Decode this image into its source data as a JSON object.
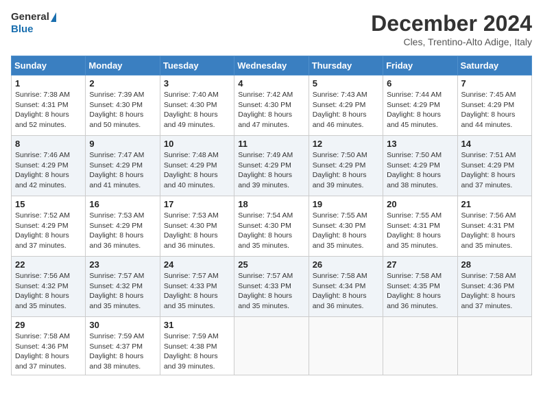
{
  "header": {
    "logo_line1": "General",
    "logo_line2": "Blue",
    "month_title": "December 2024",
    "location": "Cles, Trentino-Alto Adige, Italy"
  },
  "weekdays": [
    "Sunday",
    "Monday",
    "Tuesday",
    "Wednesday",
    "Thursday",
    "Friday",
    "Saturday"
  ],
  "weeks": [
    [
      {
        "day": "1",
        "sunrise": "7:38 AM",
        "sunset": "4:31 PM",
        "daylight": "8 hours and 52 minutes."
      },
      {
        "day": "2",
        "sunrise": "7:39 AM",
        "sunset": "4:30 PM",
        "daylight": "8 hours and 50 minutes."
      },
      {
        "day": "3",
        "sunrise": "7:40 AM",
        "sunset": "4:30 PM",
        "daylight": "8 hours and 49 minutes."
      },
      {
        "day": "4",
        "sunrise": "7:42 AM",
        "sunset": "4:30 PM",
        "daylight": "8 hours and 47 minutes."
      },
      {
        "day": "5",
        "sunrise": "7:43 AM",
        "sunset": "4:29 PM",
        "daylight": "8 hours and 46 minutes."
      },
      {
        "day": "6",
        "sunrise": "7:44 AM",
        "sunset": "4:29 PM",
        "daylight": "8 hours and 45 minutes."
      },
      {
        "day": "7",
        "sunrise": "7:45 AM",
        "sunset": "4:29 PM",
        "daylight": "8 hours and 44 minutes."
      }
    ],
    [
      {
        "day": "8",
        "sunrise": "7:46 AM",
        "sunset": "4:29 PM",
        "daylight": "8 hours and 42 minutes."
      },
      {
        "day": "9",
        "sunrise": "7:47 AM",
        "sunset": "4:29 PM",
        "daylight": "8 hours and 41 minutes."
      },
      {
        "day": "10",
        "sunrise": "7:48 AM",
        "sunset": "4:29 PM",
        "daylight": "8 hours and 40 minutes."
      },
      {
        "day": "11",
        "sunrise": "7:49 AM",
        "sunset": "4:29 PM",
        "daylight": "8 hours and 39 minutes."
      },
      {
        "day": "12",
        "sunrise": "7:50 AM",
        "sunset": "4:29 PM",
        "daylight": "8 hours and 39 minutes."
      },
      {
        "day": "13",
        "sunrise": "7:50 AM",
        "sunset": "4:29 PM",
        "daylight": "8 hours and 38 minutes."
      },
      {
        "day": "14",
        "sunrise": "7:51 AM",
        "sunset": "4:29 PM",
        "daylight": "8 hours and 37 minutes."
      }
    ],
    [
      {
        "day": "15",
        "sunrise": "7:52 AM",
        "sunset": "4:29 PM",
        "daylight": "8 hours and 37 minutes."
      },
      {
        "day": "16",
        "sunrise": "7:53 AM",
        "sunset": "4:29 PM",
        "daylight": "8 hours and 36 minutes."
      },
      {
        "day": "17",
        "sunrise": "7:53 AM",
        "sunset": "4:30 PM",
        "daylight": "8 hours and 36 minutes."
      },
      {
        "day": "18",
        "sunrise": "7:54 AM",
        "sunset": "4:30 PM",
        "daylight": "8 hours and 35 minutes."
      },
      {
        "day": "19",
        "sunrise": "7:55 AM",
        "sunset": "4:30 PM",
        "daylight": "8 hours and 35 minutes."
      },
      {
        "day": "20",
        "sunrise": "7:55 AM",
        "sunset": "4:31 PM",
        "daylight": "8 hours and 35 minutes."
      },
      {
        "day": "21",
        "sunrise": "7:56 AM",
        "sunset": "4:31 PM",
        "daylight": "8 hours and 35 minutes."
      }
    ],
    [
      {
        "day": "22",
        "sunrise": "7:56 AM",
        "sunset": "4:32 PM",
        "daylight": "8 hours and 35 minutes."
      },
      {
        "day": "23",
        "sunrise": "7:57 AM",
        "sunset": "4:32 PM",
        "daylight": "8 hours and 35 minutes."
      },
      {
        "day": "24",
        "sunrise": "7:57 AM",
        "sunset": "4:33 PM",
        "daylight": "8 hours and 35 minutes."
      },
      {
        "day": "25",
        "sunrise": "7:57 AM",
        "sunset": "4:33 PM",
        "daylight": "8 hours and 35 minutes."
      },
      {
        "day": "26",
        "sunrise": "7:58 AM",
        "sunset": "4:34 PM",
        "daylight": "8 hours and 36 minutes."
      },
      {
        "day": "27",
        "sunrise": "7:58 AM",
        "sunset": "4:35 PM",
        "daylight": "8 hours and 36 minutes."
      },
      {
        "day": "28",
        "sunrise": "7:58 AM",
        "sunset": "4:36 PM",
        "daylight": "8 hours and 37 minutes."
      }
    ],
    [
      {
        "day": "29",
        "sunrise": "7:58 AM",
        "sunset": "4:36 PM",
        "daylight": "8 hours and 37 minutes."
      },
      {
        "day": "30",
        "sunrise": "7:59 AM",
        "sunset": "4:37 PM",
        "daylight": "8 hours and 38 minutes."
      },
      {
        "day": "31",
        "sunrise": "7:59 AM",
        "sunset": "4:38 PM",
        "daylight": "8 hours and 39 minutes."
      },
      null,
      null,
      null,
      null
    ]
  ]
}
